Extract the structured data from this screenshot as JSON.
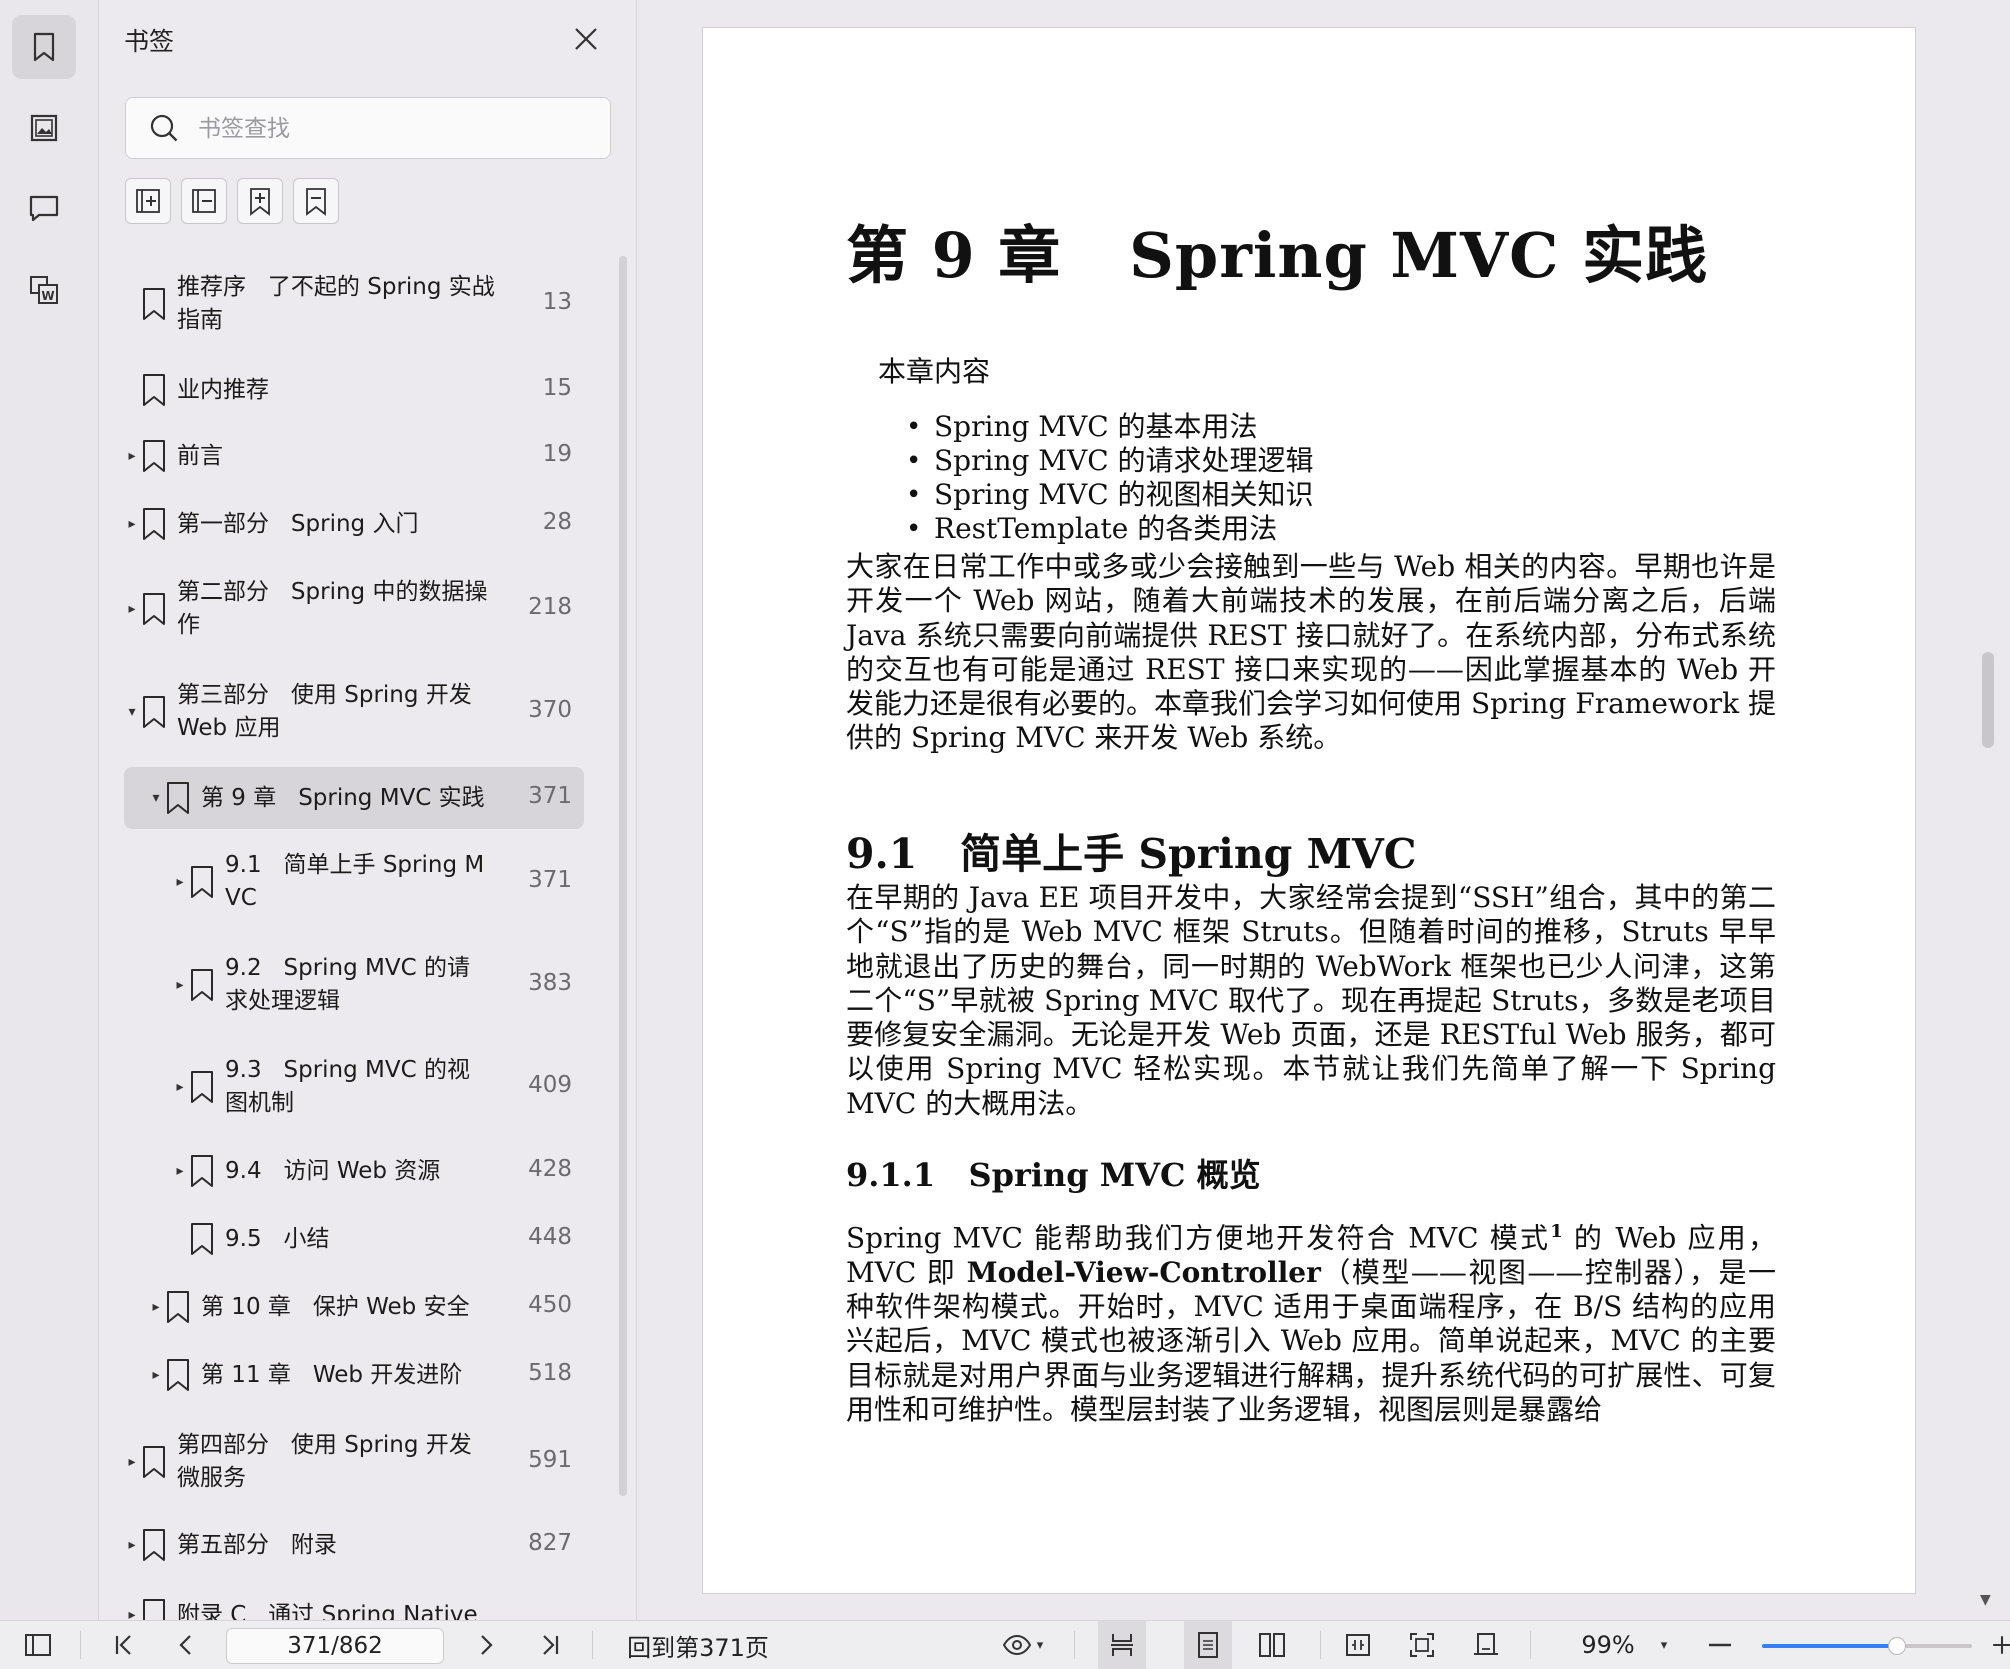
{
  "sidebar_rail": {
    "items": [
      {
        "icon": "bookmark-icon",
        "active": true
      },
      {
        "icon": "image-icon",
        "active": false
      },
      {
        "icon": "comment-icon",
        "active": false
      },
      {
        "icon": "word-convert-icon",
        "active": false
      }
    ]
  },
  "bookmark_panel": {
    "title": "书签",
    "search_placeholder": "书签查找",
    "tools": [
      "expand-all-icon",
      "collapse-all-icon",
      "add-bookmark-icon",
      "bookmark-flag-icon"
    ],
    "items": [
      {
        "label": "推荐序   了不起的 Spring 实战\n指南",
        "page": "13",
        "arrow": ""
      },
      {
        "label": "业内推荐",
        "page": "15",
        "arrow": ""
      },
      {
        "label": "前言",
        "page": "19",
        "arrow": "▸"
      },
      {
        "label": "第一部分   Spring 入门",
        "page": "28",
        "arrow": "▸"
      },
      {
        "label": "第二部分   Spring 中的数据操\n作",
        "page": "218",
        "arrow": "▸"
      },
      {
        "label": "第三部分   使用 Spring 开发\nWeb 应用",
        "page": "370",
        "arrow": "▾"
      },
      {
        "label": "第 9 章   Spring MVC 实践",
        "page": "371",
        "arrow": "▾"
      },
      {
        "label": "9.1   简单上手 Spring M\nVC",
        "page": "371",
        "arrow": "▸"
      },
      {
        "label": "9.2   Spring MVC 的请\n求处理逻辑",
        "page": "383",
        "arrow": "▸"
      },
      {
        "label": "9.3   Spring MVC 的视\n图机制",
        "page": "409",
        "arrow": "▸"
      },
      {
        "label": "9.4   访问 Web 资源",
        "page": "428",
        "arrow": "▸"
      },
      {
        "label": "9.5   小结",
        "page": "448",
        "arrow": ""
      },
      {
        "label": "第 10 章   保护 Web 安全",
        "page": "450",
        "arrow": "▸"
      },
      {
        "label": "第 11 章   Web 开发进阶",
        "page": "518",
        "arrow": "▸"
      },
      {
        "label": "第四部分   使用 Spring 开发\n微服务",
        "page": "591",
        "arrow": "▸"
      },
      {
        "label": "第五部分   附录",
        "page": "827",
        "arrow": "▸"
      },
      {
        "label": "附录 C   通过 Spring Native",
        "page": "",
        "arrow": "▸"
      }
    ]
  },
  "document": {
    "chapter_title": "第 9 章   Spring MVC 实践",
    "summary_label": "本章内容",
    "summary_items": [
      "Spring MVC 的基本用法",
      "Spring MVC 的请求处理逻辑",
      "Spring MVC 的视图相关知识",
      "RestTemplate 的各类用法"
    ],
    "para1": "大家在日常工作中或多或少会接触到一些与 Web 相关的内容。早期也许是开发一个 Web 网站，随着大前端技术的发展，在前后端分离之后，后端 Java 系统只需要向前端提供 REST 接口就好了。在系统内部，分布式系统的交互也有可能是通过 REST 接口来实现的——因此掌握基本的 Web 开发能力还是很有必要的。本章我们会学习如何使用 Spring Framework 提供的 Spring MVC 来开发 Web 系统。",
    "h2": "9.1   简单上手 Spring MVC",
    "para2": "在早期的 Java EE 项目开发中，大家经常会提到“SSH”组合，其中的第二个“S”指的是 Web MVC 框架 Struts。但随着时间的推移，Struts 早早地就退出了历史的舞台，同一时期的 WebWork 框架也已少人问津，这第二个“S”早就被 Spring MVC 取代了。现在再提起 Struts，多数是老项目要修复安全漏洞。无论是开发 Web 页面，还是 RESTful Web 服务，都可以使用 Spring MVC 轻松实现。本节就让我们先简单了解一下 Spring MVC 的大概用法。",
    "h3": "9.1.1   Spring MVC 概览",
    "para3_a": "Spring MVC 能帮助我们方便地开发符合 MVC 模式",
    "para3_sup": "1",
    "para3_b": " 的 Web 应用，MVC 即 ",
    "para3_bold": "Model-View-Controller",
    "para3_c": "（模型——视图——控制器），是一种软件架构模式。开始时，MVC 适用于桌面端程序，在 B/S 结构的应用兴起后，MVC 模式也被逐渐引入 Web 应用。简单说起来，MVC 的主要目标就是对用户界面与业务逻辑进行解耦，提升系统代码的可扩展性、可复用性和可维护性。模型层封装了业务逻辑，视图层则是暴露给"
  },
  "bottombar": {
    "page_value": "371/862",
    "back_to": "回到第371页",
    "zoom": "99%",
    "zoom_level": 0.64
  },
  "colors": {
    "accent": "#3b7cf2",
    "panel_bg": "#eceaee",
    "selected_bg": "#d7d5da"
  }
}
